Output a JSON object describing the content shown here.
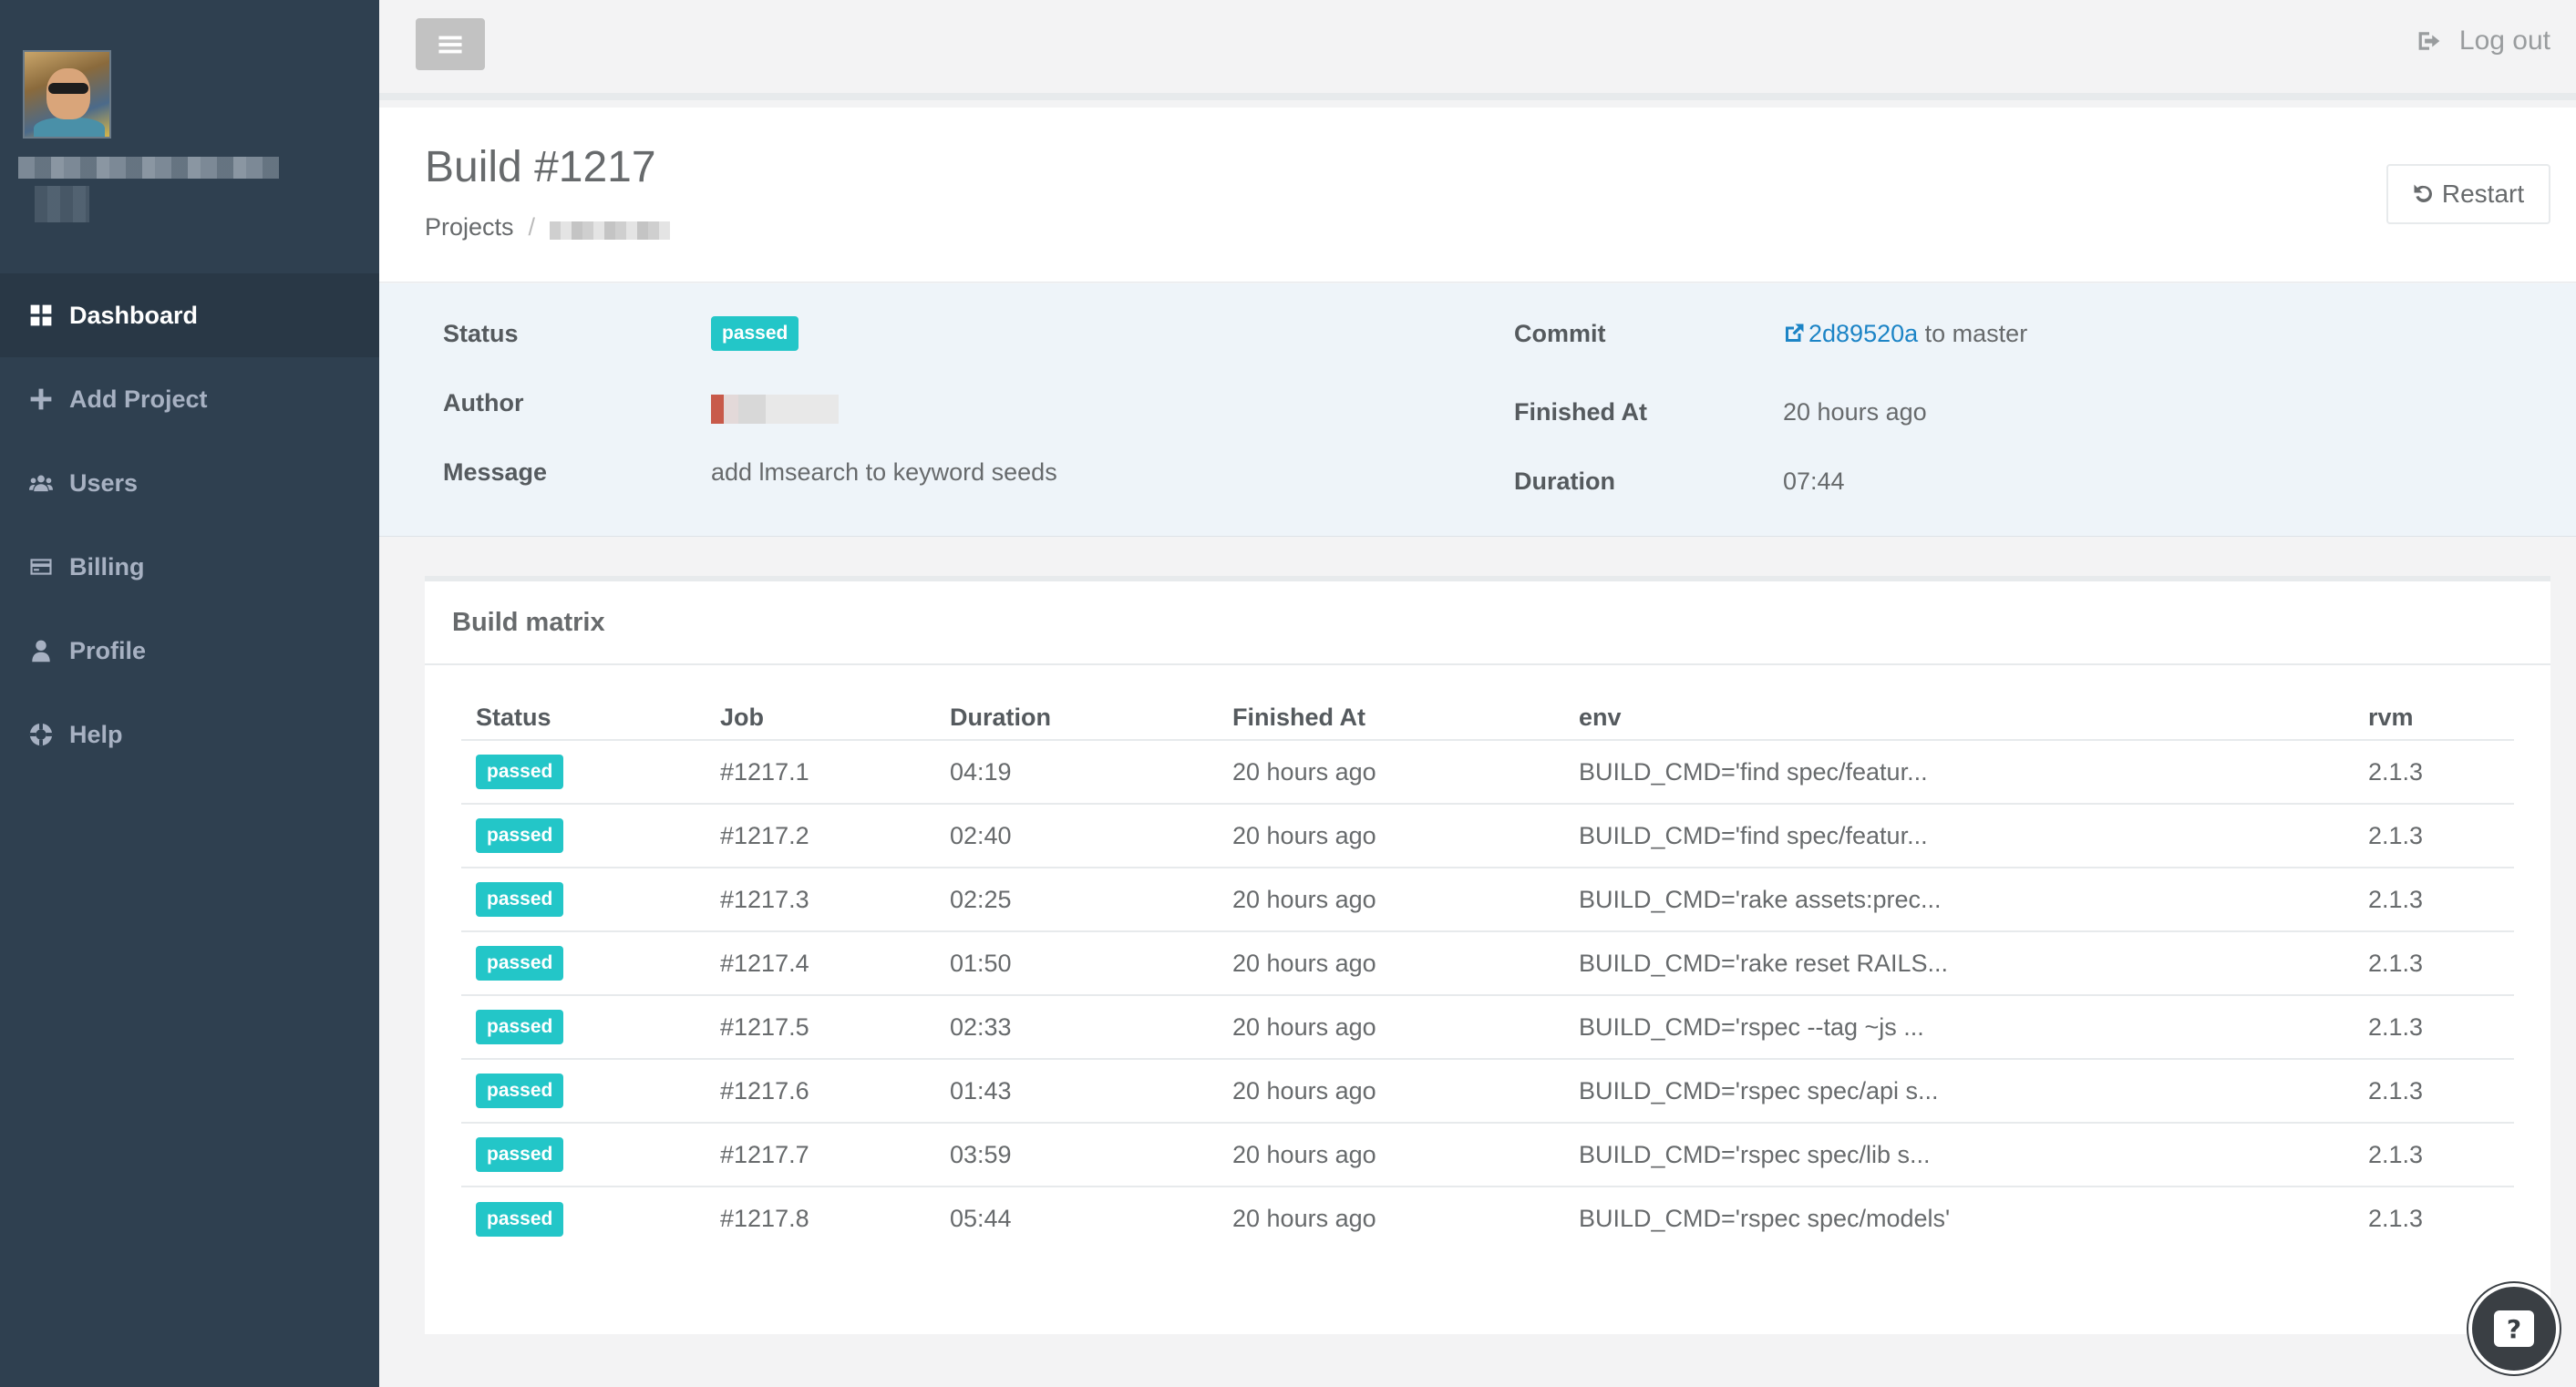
{
  "sidebar": {
    "items": [
      {
        "label": "Dashboard",
        "icon": "dashboard-icon",
        "active": true
      },
      {
        "label": "Add Project",
        "icon": "plus-icon",
        "active": false
      },
      {
        "label": "Users",
        "icon": "users-icon",
        "active": false
      },
      {
        "label": "Billing",
        "icon": "credit-card-icon",
        "active": false
      },
      {
        "label": "Profile",
        "icon": "user-icon",
        "active": false
      },
      {
        "label": "Help",
        "icon": "life-ring-icon",
        "active": false
      }
    ]
  },
  "topbar": {
    "logout_label": "Log out"
  },
  "header": {
    "title": "Build #1217",
    "breadcrumb_root": "Projects",
    "breadcrumb_sep": "/",
    "restart_label": "Restart"
  },
  "summary": {
    "status_label": "Status",
    "status_value": "passed",
    "author_label": "Author",
    "message_label": "Message",
    "message_value": "add lmsearch to keyword seeds",
    "commit_label": "Commit",
    "commit_hash": "2d89520a",
    "commit_suffix": "to master",
    "finished_label": "Finished At",
    "finished_value": "20 hours ago",
    "duration_label": "Duration",
    "duration_value": "07:44"
  },
  "matrix": {
    "title": "Build matrix",
    "columns": [
      "Status",
      "Job",
      "Duration",
      "Finished At",
      "env",
      "rvm"
    ],
    "rows": [
      {
        "status": "passed",
        "job": "#1217.1",
        "duration": "04:19",
        "finished": "20 hours ago",
        "env": "BUILD_CMD='find spec/featur...",
        "rvm": "2.1.3"
      },
      {
        "status": "passed",
        "job": "#1217.2",
        "duration": "02:40",
        "finished": "20 hours ago",
        "env": "BUILD_CMD='find spec/featur...",
        "rvm": "2.1.3"
      },
      {
        "status": "passed",
        "job": "#1217.3",
        "duration": "02:25",
        "finished": "20 hours ago",
        "env": "BUILD_CMD='rake assets:prec...",
        "rvm": "2.1.3"
      },
      {
        "status": "passed",
        "job": "#1217.4",
        "duration": "01:50",
        "finished": "20 hours ago",
        "env": "BUILD_CMD='rake reset RAILS...",
        "rvm": "2.1.3"
      },
      {
        "status": "passed",
        "job": "#1217.5",
        "duration": "02:33",
        "finished": "20 hours ago",
        "env": "BUILD_CMD='rspec --tag ~js ...",
        "rvm": "2.1.3"
      },
      {
        "status": "passed",
        "job": "#1217.6",
        "duration": "01:43",
        "finished": "20 hours ago",
        "env": "BUILD_CMD='rspec spec/api s...",
        "rvm": "2.1.3"
      },
      {
        "status": "passed",
        "job": "#1217.7",
        "duration": "03:59",
        "finished": "20 hours ago",
        "env": "BUILD_CMD='rspec spec/lib s...",
        "rvm": "2.1.3"
      },
      {
        "status": "passed",
        "job": "#1217.8",
        "duration": "05:44",
        "finished": "20 hours ago",
        "env": "BUILD_CMD='rspec spec/models'",
        "rvm": "2.1.3"
      }
    ]
  },
  "help_bubble": {
    "glyph": "?"
  },
  "colors": {
    "sidebar_bg": "#2f4050",
    "sidebar_active_bg": "#293846",
    "badge_passed": "#23c6c8",
    "link": "#1c84c6"
  }
}
